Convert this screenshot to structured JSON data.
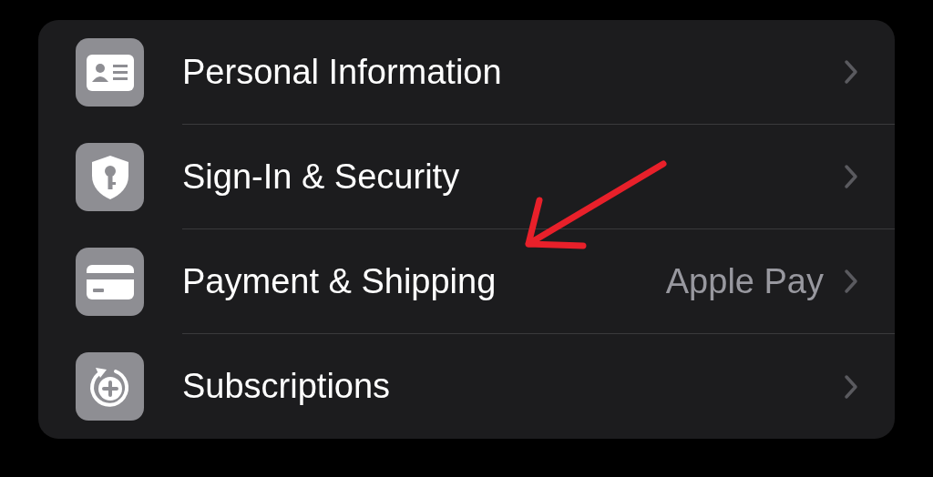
{
  "rows": [
    {
      "kind": "id-card",
      "label": "Personal Information"
    },
    {
      "kind": "shield-key",
      "label": "Sign-In & Security"
    },
    {
      "kind": "card",
      "label": "Payment & Shipping",
      "value": "Apple Pay"
    },
    {
      "kind": "renew",
      "label": "Subscriptions"
    }
  ],
  "annotation": {
    "kind": "arrow"
  }
}
